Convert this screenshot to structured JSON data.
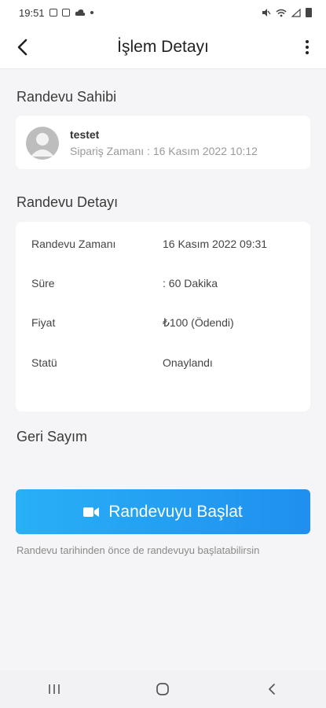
{
  "status_bar": {
    "time": "19:51"
  },
  "header": {
    "title": "İşlem Detayı",
    "back_icon": "chevron-left-icon",
    "menu_icon": "more-vertical-icon"
  },
  "owner_section": {
    "title": "Randevu Sahibi",
    "name": "testet",
    "order_label": "Sipariş Zamanı : 16 Kasım 2022 10:12",
    "avatar_icon": "user-avatar-icon"
  },
  "detail_section": {
    "title": "Randevu Detayı",
    "rows": [
      {
        "label": "Randevu Zamanı",
        "value": "16 Kasım 2022 09:31"
      },
      {
        "label": "Süre",
        "value": ": 60 Dakika"
      },
      {
        "label": "Fiyat",
        "value": "₺100 (Ödendi)"
      },
      {
        "label": "Statü",
        "value": "Onaylandı"
      }
    ]
  },
  "countdown": {
    "title": "Geri Sayım"
  },
  "start": {
    "label": "Randevuyu Başlat",
    "icon": "video-camera-icon",
    "hint": "Randevu tarihinden önce de randevuyu başlatabilirsin",
    "gradient": [
      "#29b0f5",
      "#1f8ff0"
    ]
  },
  "nav": {
    "icons": [
      "recent-apps-icon",
      "home-icon",
      "back-icon"
    ]
  }
}
